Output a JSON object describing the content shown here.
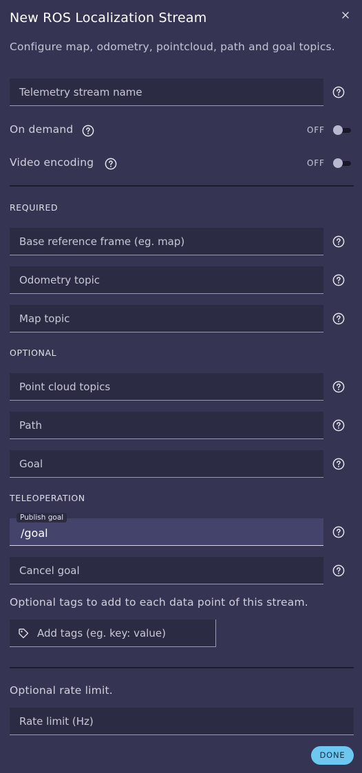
{
  "dialog": {
    "title": "New ROS Localization Stream",
    "subtitle": "Configure map, odometry, pointcloud, path and goal topics."
  },
  "fields": {
    "stream_name": {
      "placeholder": "Telemetry stream name"
    },
    "base_frame": {
      "placeholder": "Base reference frame (eg. map)"
    },
    "odometry": {
      "placeholder": "Odometry topic"
    },
    "map": {
      "placeholder": "Map topic"
    },
    "point_cloud": {
      "placeholder": "Point cloud topics"
    },
    "path": {
      "placeholder": "Path"
    },
    "goal": {
      "placeholder": "Goal"
    },
    "publish_goal": {
      "label": "Publish goal",
      "value": "/goal"
    },
    "cancel_goal": {
      "placeholder": "Cancel goal"
    },
    "tags": {
      "placeholder": "Add tags (eg. key: value)"
    },
    "rate_limit": {
      "placeholder": "Rate limit (Hz)"
    }
  },
  "toggles": {
    "on_demand": {
      "label": "On demand",
      "state": "OFF"
    },
    "video_encoding": {
      "label": "Video encoding",
      "state": "OFF"
    }
  },
  "sections": {
    "required": "REQUIRED",
    "optional": "OPTIONAL",
    "teleoperation": "TELEOPERATION"
  },
  "hints": {
    "tags": "Optional tags to add to each data point of this stream.",
    "rate": "Optional rate limit."
  },
  "actions": {
    "done": "DONE"
  },
  "icons": {
    "close": "close-icon",
    "help": "help-circle-icon",
    "tag": "tag-icon"
  },
  "colors": {
    "background": "#353553",
    "field_background": "#2b2b43",
    "field_active": "#43436b",
    "accent": "#6cc8f0"
  }
}
